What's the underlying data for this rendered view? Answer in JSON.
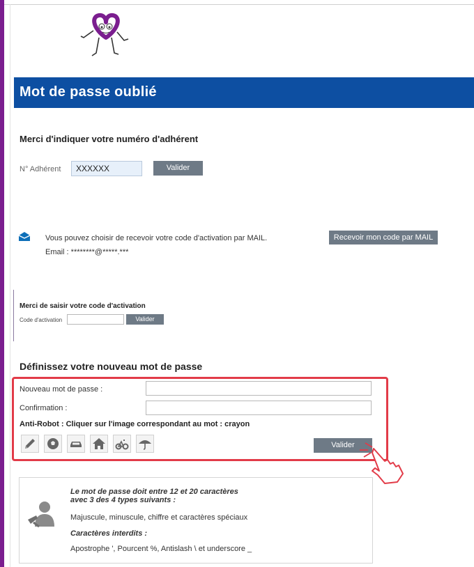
{
  "header": {
    "title": "Mot de passe oublié"
  },
  "member_section": {
    "title": "Merci d'indiquer votre numéro d'adhérent",
    "label": "N° Adhérent",
    "value": "XXXXXX",
    "button": "Valider"
  },
  "mail_section": {
    "text": "Vous pouvez choisir de recevoir votre code d'activation par MAIL.",
    "email": "Email : ********@*****.***",
    "button": "Recevoir mon code par MAIL"
  },
  "activation_section": {
    "title": "Merci de saisir votre code d'activation",
    "label": "Code d'activation",
    "button": "Valider"
  },
  "password_section": {
    "title": "Définissez votre nouveau mot de passe",
    "new_label": "Nouveau mot de passe :",
    "confirm_label": "Confirmation :",
    "antirobot": "Anti-Robot : Cliquer sur l'image correspondant au mot : crayon",
    "robot_icons": [
      "pencil-icon",
      "football-icon",
      "car-icon",
      "house-icon",
      "bicycle-icon",
      "umbrella-icon"
    ],
    "button": "Valider"
  },
  "info": {
    "rule_line1": "Le mot de passe doit entre 12 et 20 caractères",
    "rule_line2": "avec 3 des 4 types suivants :",
    "types": "Majuscule, minuscule, chiffre et caractères spéciaux",
    "forbidden_title": "Caractères interdits :",
    "forbidden": "Apostrophe ', Pourcent %, Antislash \\ et underscore _"
  },
  "colors": {
    "header": "#0d4fa2",
    "highlight": "#e23b48",
    "button": "#6e7a86",
    "accent": "#7b1e8f"
  }
}
